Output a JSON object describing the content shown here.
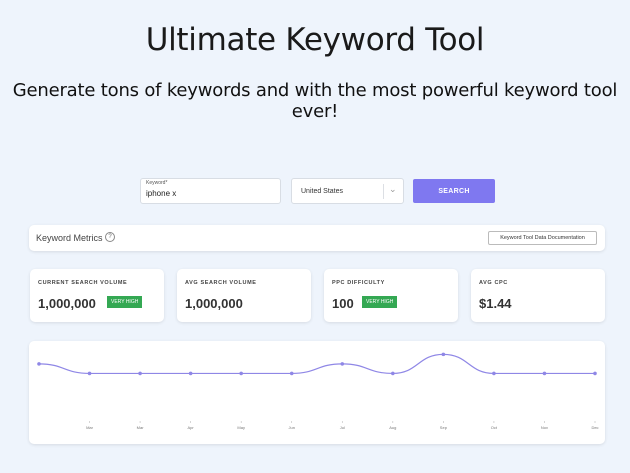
{
  "hero": {
    "title": "Ultimate Keyword Tool",
    "subtitle": "Generate tons of keywords and with the most powerful keyword tool ever!"
  },
  "search": {
    "keyword_label": "Keyword*",
    "keyword_value": "iphone x",
    "country_value": "United States",
    "button_label": "SEARCH"
  },
  "metrics_bar": {
    "title": "Keyword Metrics",
    "help_glyph": "?",
    "doc_button": "Keyword Tool Data Documentation"
  },
  "stats": [
    {
      "label": "CURRENT SEARCH VOLUME",
      "value": "1,000,000",
      "badge": "VERY HIGH"
    },
    {
      "label": "AVG SEARCH VOLUME",
      "value": "1,000,000",
      "badge": ""
    },
    {
      "label": "PPC DIFFICULTY",
      "value": "100",
      "badge": "VERY HIGH"
    },
    {
      "label": "AVG CPC",
      "value": "$1.44",
      "badge": ""
    }
  ],
  "colors": {
    "accent": "#7f78f0",
    "badge_green": "#34a853",
    "line": "#8f87e6",
    "background": "#eef4fc"
  },
  "icons": {
    "help": "question-circle-icon",
    "dropdown": "chevron-down-icon"
  },
  "chart_data": {
    "type": "line",
    "categories": [
      "Jan",
      "Feb",
      "Mar",
      "Apr",
      "May",
      "Jun",
      "Jul",
      "Aug",
      "Sep",
      "Oct",
      "Nov",
      "Dec"
    ],
    "series": [
      {
        "values": [
          0.8,
          0.6,
          0.6,
          0.6,
          0.6,
          0.6,
          0.8,
          0.6,
          1.0,
          0.6,
          0.6,
          0.6
        ]
      }
    ],
    "tick_labels": [
      "",
      "Mar",
      "Mar",
      "Apr",
      "May",
      "Jun",
      "Jul",
      "Aug",
      "Sep",
      "Oct",
      "Nov",
      "Dec"
    ],
    "ylim": [
      0,
      1.05
    ],
    "grid": false
  }
}
